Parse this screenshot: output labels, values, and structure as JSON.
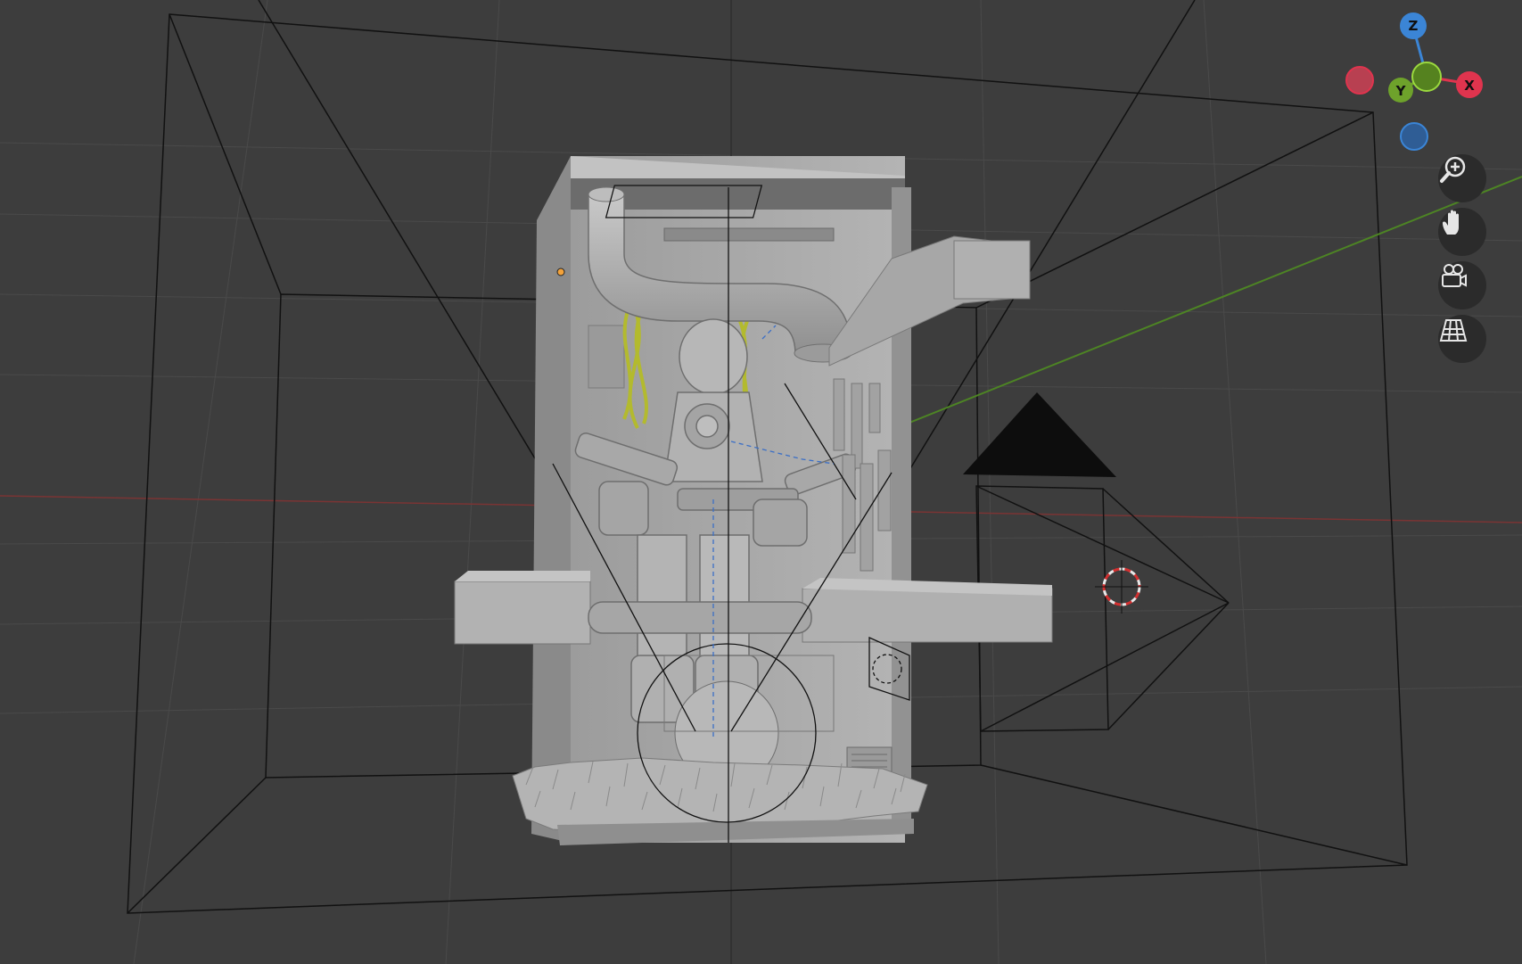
{
  "gizmo": {
    "z_label": "Z",
    "y_label": "Y",
    "x_label": "X",
    "colors": {
      "x": "#e0344e",
      "y": "#6ea22b",
      "z": "#3b85d6"
    }
  },
  "navigation": [
    {
      "name": "zoom-icon"
    },
    {
      "name": "hand-pan-icon"
    },
    {
      "name": "camera-view-icon"
    },
    {
      "name": "ortho-grid-icon"
    }
  ],
  "viewport": {
    "background": "#3d3d3d",
    "model_color": "#a7a7a7",
    "wire_color": "#46851f"
  }
}
